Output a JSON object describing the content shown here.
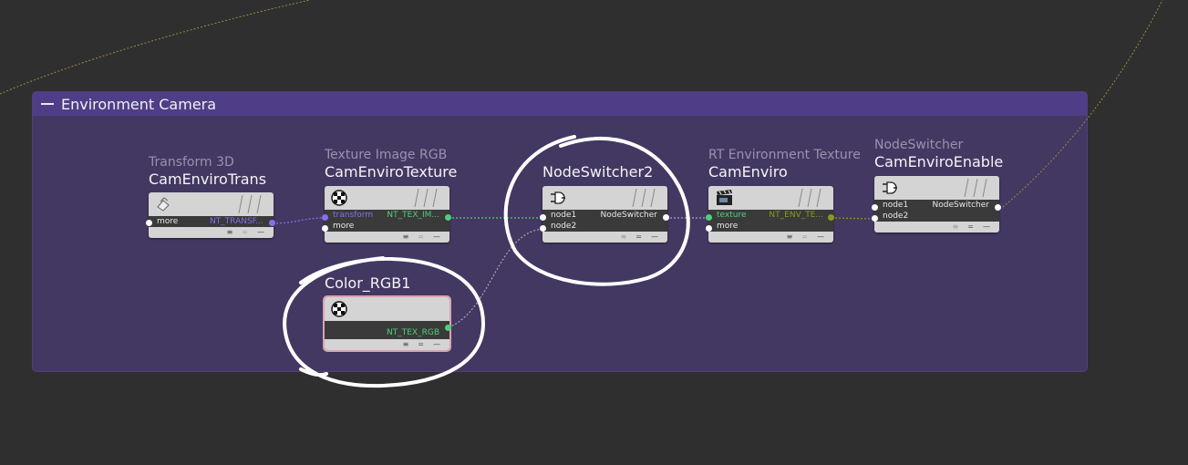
{
  "group": {
    "title": "Environment Camera",
    "color": "#433862"
  },
  "nodes": {
    "transform": {
      "type": "Transform 3D",
      "name": "CamEnviroTrans",
      "icon": "transform-icon",
      "input_label": "more",
      "output_label": "NT_TRANSF...",
      "output_color": "#8a6cf0"
    },
    "texture": {
      "type": "Texture Image RGB",
      "name": "CamEnviroTexture",
      "icon": "checker-icon",
      "input_label": "transform",
      "input2_label": "more",
      "output_label": "NT_TEX_IM...",
      "input_color": "#8a6cf0",
      "output_color": "#4fcf7a"
    },
    "switcher2": {
      "name": "NodeSwitcher2",
      "icon": "plug-icon",
      "input_label": "node1",
      "input2_label": "node2",
      "output_label": "NodeSwitcher"
    },
    "color_rgb": {
      "name": "Color_RGB1",
      "icon": "checker-icon",
      "output_label": "NT_TEX_RGB",
      "output_color": "#4fcf7a"
    },
    "enviro": {
      "type": "RT Environment Texture",
      "name": "CamEnviro",
      "icon": "clapper-icon",
      "input_label": "texture",
      "input2_label": "more",
      "output_label": "NT_ENV_TE...",
      "input_color": "#4fcf7a",
      "output_color": "#8a9a1a"
    },
    "enable": {
      "type": "NodeSwitcher",
      "name": "CamEnviroEnable",
      "icon": "plug-icon",
      "input_label": "node1",
      "input2_label": "node2",
      "output_label": "NodeSwitcher"
    }
  },
  "footer_icons": [
    "list-icon",
    "equals-icon",
    "minus-icon"
  ],
  "annotations": [
    "circle-nodeswitcher2",
    "circle-color-rgb1"
  ]
}
